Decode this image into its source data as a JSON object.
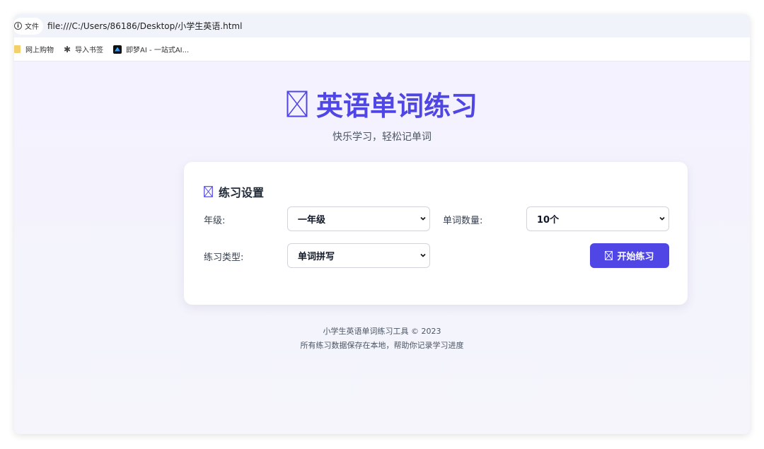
{
  "browser": {
    "site_info_label": "文件",
    "url": "file:///C:/Users/86186/Desktop/小学生英语.html",
    "bookmarks": [
      {
        "label": "网上购物",
        "icon": "folder-icon"
      },
      {
        "label": "导入书签",
        "icon": "gear-icon"
      },
      {
        "label": "即梦AI - 一站式AI...",
        "icon": "jimeng-icon"
      }
    ]
  },
  "page": {
    "title": "英语单词练习",
    "subtitle": "快乐学习，轻松记单词",
    "accent_color": "#4f46e5"
  },
  "settings": {
    "title": "练习设置",
    "grade_label": "年级:",
    "grade_value": "一年级",
    "count_label": "单词数量:",
    "count_value": "10个",
    "type_label": "练习类型:",
    "type_value": "单词拼写",
    "start_button": "开始练习"
  },
  "footer": {
    "line1": "小学生英语单词练习工具 © 2023",
    "line2": "所有练习数据保存在本地，帮助你记录学习进度"
  }
}
